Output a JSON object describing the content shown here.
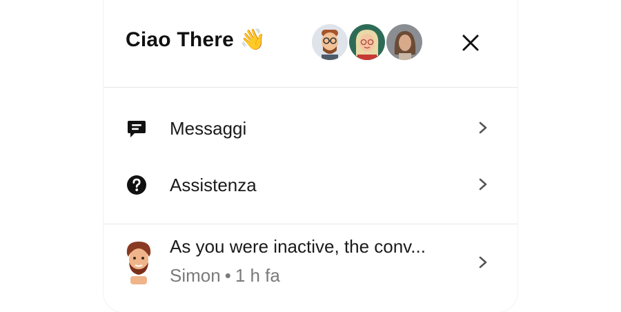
{
  "header": {
    "title": "Ciao There 👋",
    "team_avatars": [
      "avatar-man-glasses",
      "avatar-woman-blonde",
      "avatar-woman-photo"
    ],
    "close_icon": "close-icon"
  },
  "menu": {
    "items": [
      {
        "label": "Messaggi",
        "icon": "message-icon"
      },
      {
        "label": "Assistenza",
        "icon": "help-circle-icon"
      }
    ]
  },
  "conversation": {
    "preview": "As you were inactive, the conv...",
    "author": "Simon",
    "separator": "•",
    "time": "1 h fa"
  },
  "colors": {
    "text": "#1a1a1a",
    "muted": "#7a7a7a",
    "divider": "#e6e6e6"
  }
}
